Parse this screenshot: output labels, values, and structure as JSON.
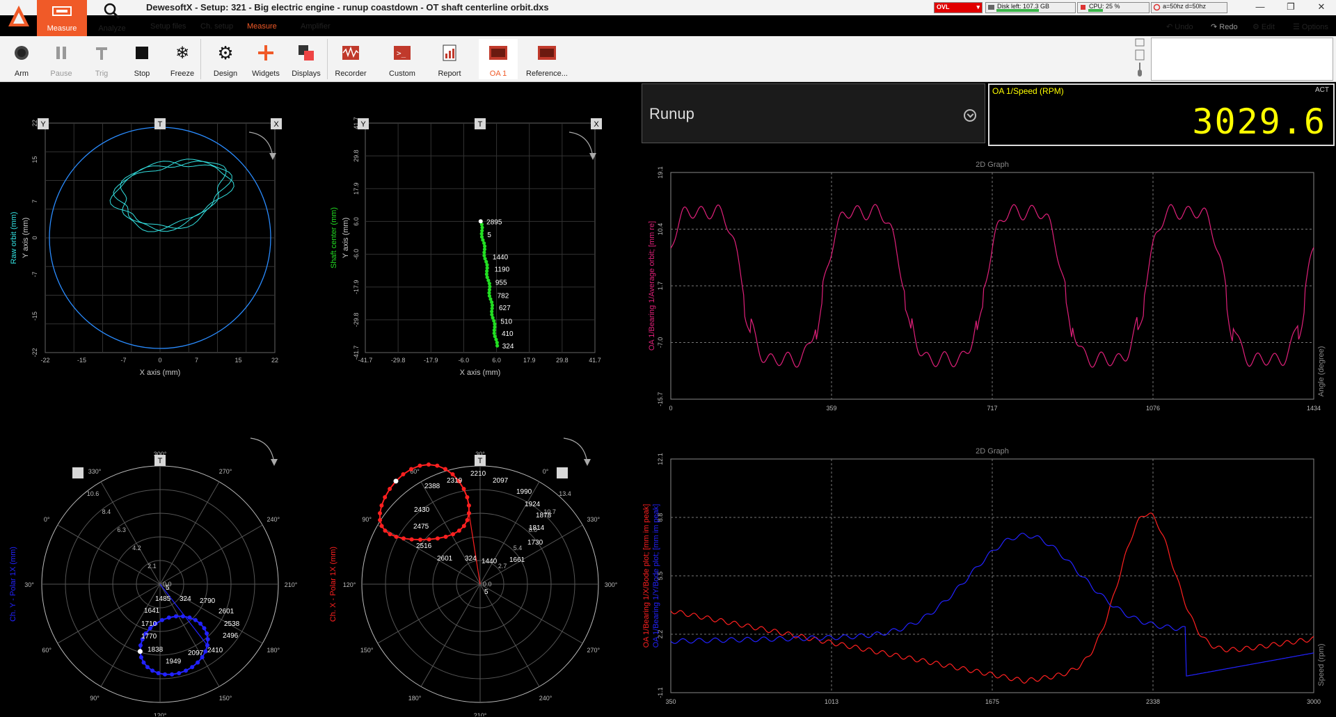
{
  "app": {
    "title": "DewesoftX - Setup: 321 - Big electric engine - runup coastdown - OT shaft centerline orbit.dxs",
    "menu": {
      "measure": "Measure",
      "analyze": "Analyze"
    },
    "subtabs": [
      "Setup files",
      "Ch. setup",
      "Measure",
      "Amplifier"
    ],
    "active_subtab": "Measure",
    "accent": "#f05a28"
  },
  "status": {
    "ovl": "OVL",
    "disk": "Disk left: 107.3 GB",
    "disk_fill": 0.55,
    "cpu": "CPU: 25 %",
    "cpu_fill": 0.25,
    "rate": "a=50hz d=50hz"
  },
  "actions": {
    "undo": "Undo",
    "redo": "Redo",
    "edit": "Edit",
    "options": "Options"
  },
  "toolbar": [
    {
      "id": "arm",
      "label": "Arm",
      "icon": "record-circle-icon",
      "disabled": false
    },
    {
      "id": "pause",
      "label": "Pause",
      "icon": "pause-icon",
      "disabled": true
    },
    {
      "id": "trig",
      "label": "Trig",
      "icon": "trigger-icon",
      "disabled": true
    },
    {
      "id": "stop",
      "label": "Stop",
      "icon": "stop-square-icon",
      "disabled": false
    },
    {
      "id": "freeze",
      "label": "Freeze",
      "icon": "snowflake-icon",
      "disabled": false
    },
    {
      "id": "design",
      "label": "Design",
      "icon": "gear-icon",
      "disabled": false
    },
    {
      "id": "widgets",
      "label": "Widgets",
      "icon": "plus-icon",
      "disabled": false
    },
    {
      "id": "displays",
      "label": "Displays",
      "icon": "displays-icon",
      "disabled": false
    },
    {
      "id": "recorder",
      "label": "Recorder",
      "icon": "recorder-icon",
      "disabled": false
    },
    {
      "id": "custom",
      "label": "Custom",
      "icon": "terminal-icon",
      "disabled": false
    },
    {
      "id": "report",
      "label": "Report",
      "icon": "report-icon",
      "disabled": false
    },
    {
      "id": "oa1",
      "label": "OA 1",
      "icon": "display-thumb-icon",
      "disabled": false,
      "active": true
    },
    {
      "id": "reference",
      "label": "Reference...",
      "icon": "display-thumb-icon",
      "disabled": false
    }
  ],
  "selector": {
    "value": "Runup"
  },
  "digital_meter": {
    "name": "OA 1/Speed (RPM)",
    "mode": "ACT",
    "value": "3029.6",
    "color": "#ffff00"
  },
  "orbit_raw": {
    "markers": [
      "Y",
      "T",
      "X"
    ],
    "ylabel_channel": "Raw orbit (mm)",
    "ylabel_axis": "Y axis (mm)",
    "xlabel": "X axis (mm)",
    "x_ticks": [
      "-22",
      "-15",
      "-7",
      "0",
      "7",
      "15",
      "22"
    ],
    "y_ticks": [
      "22",
      "15",
      "7",
      "0",
      "-7",
      "-15",
      "-22"
    ],
    "color": "#33e0e0",
    "circle_color": "#2a8cff"
  },
  "shaft_center": {
    "markers": [
      "Y",
      "T",
      "X"
    ],
    "ylabel_channel": "Shaft center (mm)",
    "ylabel_axis": "Y axis (mm)",
    "xlabel": "X axis (mm)",
    "x_ticks": [
      "-41.7",
      "-29.8",
      "-17.9",
      "-6.0",
      "6.0",
      "17.9",
      "29.8",
      "41.7"
    ],
    "y_ticks": [
      "41.7",
      "29.8",
      "17.9",
      "6.0",
      "-6.0",
      "-17.9",
      "-29.8",
      "-41.7"
    ],
    "labels": [
      {
        "text": "2895",
        "x": 0.3,
        "y": 6.0
      },
      {
        "text": "5",
        "x": 0.6,
        "y": 1.3
      },
      {
        "text": "1440",
        "x": 2.5,
        "y": -6.8
      },
      {
        "text": "1190",
        "x": 3.2,
        "y": -11.2
      },
      {
        "text": "955",
        "x": 3.5,
        "y": -16.0
      },
      {
        "text": "782",
        "x": 4.2,
        "y": -20.8
      },
      {
        "text": "627",
        "x": 4.8,
        "y": -25.3
      },
      {
        "text": "510",
        "x": 5.4,
        "y": -30.2
      },
      {
        "text": "410",
        "x": 5.8,
        "y": -34.6
      },
      {
        "text": "324",
        "x": 6.0,
        "y": -39.2
      }
    ],
    "color": "#22dd22"
  },
  "polar_y": {
    "title": "Ch. Y - Polar 1X (mm)",
    "marker": "T",
    "angles": [
      "330°",
      "300°",
      "270°",
      "240°",
      "210°",
      "180°",
      "150°",
      "120°",
      "90°",
      "60°",
      "30°",
      "0°"
    ],
    "radial_ticks": [
      "10.6",
      "8.4",
      "6.3",
      "4.2",
      "2.1",
      "0.0"
    ],
    "labels": [
      "5",
      "1485",
      "324",
      "2790",
      "1641",
      "2601",
      "1710",
      "2538",
      "1770",
      "2496",
      "1838",
      "2410",
      "2097",
      "1949"
    ],
    "color": "#2222ff"
  },
  "polar_x": {
    "title": "Ch. X - Polar 1X (mm)",
    "marker": "T",
    "angles": [
      "60°",
      "30°",
      "0°",
      "330°",
      "300°",
      "270°",
      "240°",
      "210°",
      "180°",
      "150°",
      "120°",
      "90°"
    ],
    "radial_ticks": [
      "13.4",
      "10.7",
      "8.0",
      "5.4",
      "2.7",
      "0.0"
    ],
    "labels": [
      "2210",
      "2319",
      "2097",
      "2388",
      "1990",
      "1924",
      "2430",
      "1878",
      "2475",
      "1814",
      "1730",
      "2516",
      "2601",
      "324",
      "1440",
      "1661",
      "5"
    ],
    "color": "#ff2020"
  },
  "graph_top": {
    "title": "2D Graph",
    "ylabel": "OA 1/Bearing 1/Average orbit; [mm re]",
    "y2label": "Angle (degree)",
    "x_ticks": [
      "0",
      "359",
      "717",
      "1076",
      "1434"
    ],
    "y_ticks": [
      "19.1",
      "10.4",
      "1.7",
      "-7.0",
      "-15.7"
    ],
    "color": "#e0207a"
  },
  "graph_bottom": {
    "title": "2D Graph",
    "ylabel_red": "OA 1/Bearing 1/X/Bode plot; [mm im peak]",
    "ylabel_blue": "OA 1/Bearing 1/Y/Bode plot; [mm im peak]",
    "y2label": "Speed (rpm)",
    "x_ticks": [
      "350",
      "1013",
      "1675",
      "2338",
      "3000"
    ],
    "y_ticks": [
      "12.1",
      "8.8",
      "5.5",
      "2.2",
      "-1.1"
    ],
    "color_red": "#ff2020",
    "color_blue": "#2222ff"
  }
}
